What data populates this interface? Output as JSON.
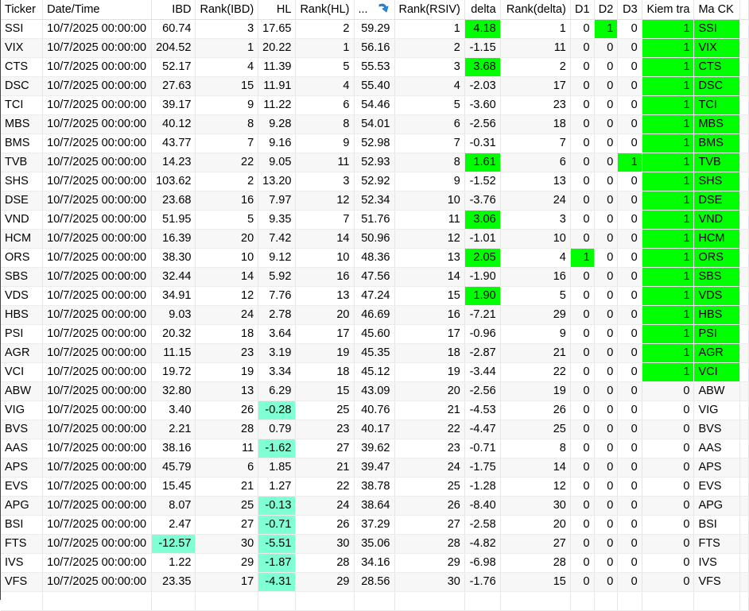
{
  "columns": [
    {
      "key": "ticker",
      "label": "Ticker",
      "align": "l"
    },
    {
      "key": "datetime",
      "label": "Date/Time",
      "align": "l"
    },
    {
      "key": "ibd",
      "label": "IBD",
      "align": "r"
    },
    {
      "key": "rank_ibd",
      "label": "Rank(IBD)",
      "align": "r"
    },
    {
      "key": "hl",
      "label": "HL",
      "align": "r"
    },
    {
      "key": "rank_hl",
      "label": "Rank(HL)",
      "align": "r"
    },
    {
      "key": "rsiv",
      "label": "...",
      "align": "l"
    },
    {
      "key": "rank_rsiv",
      "label": "Rank(RSIV)",
      "align": "r"
    },
    {
      "key": "delta",
      "label": "delta",
      "align": "r"
    },
    {
      "key": "rank_delta",
      "label": "Rank(delta)",
      "align": "r"
    },
    {
      "key": "d1",
      "label": "D1",
      "align": "r"
    },
    {
      "key": "d2",
      "label": "D2",
      "align": "r"
    },
    {
      "key": "d3",
      "label": "D3",
      "align": "r"
    },
    {
      "key": "kiem_tra",
      "label": "Kiem tra",
      "align": "r"
    },
    {
      "key": "ma_ck",
      "label": "Ma CK",
      "align": "l"
    }
  ],
  "sort_icon": "sort-descending-arrow-icon",
  "colors": {
    "green": "#00ff00",
    "aqua": "#7fffd4",
    "zebra": "#f7f7f7"
  },
  "rows": [
    {
      "v": [
        "SSI",
        "10/7/2025 00:00:00",
        "60.74",
        "3",
        "17.65",
        "2",
        "59.29",
        "1",
        "4.18",
        "1",
        "0",
        "1",
        "0",
        "1",
        "SSI"
      ],
      "g": [
        8,
        11,
        13,
        14
      ],
      "c": []
    },
    {
      "v": [
        "VIX",
        "10/7/2025 00:00:00",
        "204.52",
        "1",
        "20.22",
        "1",
        "56.16",
        "2",
        "-1.15",
        "11",
        "0",
        "0",
        "0",
        "1",
        "VIX"
      ],
      "g": [
        13,
        14
      ],
      "c": []
    },
    {
      "v": [
        "CTS",
        "10/7/2025 00:00:00",
        "52.17",
        "4",
        "11.39",
        "5",
        "55.53",
        "3",
        "3.68",
        "2",
        "0",
        "0",
        "0",
        "1",
        "CTS"
      ],
      "g": [
        8,
        13,
        14
      ],
      "c": []
    },
    {
      "v": [
        "DSC",
        "10/7/2025 00:00:00",
        "27.63",
        "15",
        "11.91",
        "4",
        "55.40",
        "4",
        "-2.03",
        "17",
        "0",
        "0",
        "0",
        "1",
        "DSC"
      ],
      "g": [
        13,
        14
      ],
      "c": []
    },
    {
      "v": [
        "TCI",
        "10/7/2025 00:00:00",
        "39.17",
        "9",
        "11.22",
        "6",
        "54.46",
        "5",
        "-3.60",
        "23",
        "0",
        "0",
        "0",
        "1",
        "TCI"
      ],
      "g": [
        13,
        14
      ],
      "c": []
    },
    {
      "v": [
        "MBS",
        "10/7/2025 00:00:00",
        "40.12",
        "8",
        "9.28",
        "8",
        "54.01",
        "6",
        "-2.56",
        "18",
        "0",
        "0",
        "0",
        "1",
        "MBS"
      ],
      "g": [
        13,
        14
      ],
      "c": []
    },
    {
      "v": [
        "BMS",
        "10/7/2025 00:00:00",
        "43.77",
        "7",
        "9.16",
        "9",
        "52.98",
        "7",
        "-0.31",
        "7",
        "0",
        "0",
        "0",
        "1",
        "BMS"
      ],
      "g": [
        13,
        14
      ],
      "c": []
    },
    {
      "v": [
        "TVB",
        "10/7/2025 00:00:00",
        "14.23",
        "22",
        "9.05",
        "11",
        "52.93",
        "8",
        "1.61",
        "6",
        "0",
        "0",
        "1",
        "1",
        "TVB"
      ],
      "g": [
        8,
        12,
        13,
        14
      ],
      "c": []
    },
    {
      "v": [
        "SHS",
        "10/7/2025 00:00:00",
        "103.62",
        "2",
        "13.20",
        "3",
        "52.92",
        "9",
        "-1.52",
        "13",
        "0",
        "0",
        "0",
        "1",
        "SHS"
      ],
      "g": [
        13,
        14
      ],
      "c": []
    },
    {
      "v": [
        "DSE",
        "10/7/2025 00:00:00",
        "23.68",
        "16",
        "7.97",
        "12",
        "52.34",
        "10",
        "-3.76",
        "24",
        "0",
        "0",
        "0",
        "1",
        "DSE"
      ],
      "g": [
        13,
        14
      ],
      "c": []
    },
    {
      "v": [
        "VND",
        "10/7/2025 00:00:00",
        "51.95",
        "5",
        "9.35",
        "7",
        "51.76",
        "11",
        "3.06",
        "3",
        "0",
        "0",
        "0",
        "1",
        "VND"
      ],
      "g": [
        8,
        13,
        14
      ],
      "c": []
    },
    {
      "v": [
        "HCM",
        "10/7/2025 00:00:00",
        "16.39",
        "20",
        "7.42",
        "14",
        "50.96",
        "12",
        "-1.01",
        "10",
        "0",
        "0",
        "0",
        "1",
        "HCM"
      ],
      "g": [
        13,
        14
      ],
      "c": []
    },
    {
      "v": [
        "ORS",
        "10/7/2025 00:00:00",
        "38.30",
        "10",
        "9.12",
        "10",
        "48.36",
        "13",
        "2.05",
        "4",
        "1",
        "0",
        "0",
        "1",
        "ORS"
      ],
      "g": [
        8,
        10,
        13,
        14
      ],
      "c": []
    },
    {
      "v": [
        "SBS",
        "10/7/2025 00:00:00",
        "32.44",
        "14",
        "5.92",
        "16",
        "47.56",
        "14",
        "-1.90",
        "16",
        "0",
        "0",
        "0",
        "1",
        "SBS"
      ],
      "g": [
        13,
        14
      ],
      "c": []
    },
    {
      "v": [
        "VDS",
        "10/7/2025 00:00:00",
        "34.91",
        "12",
        "7.76",
        "13",
        "47.24",
        "15",
        "1.90",
        "5",
        "0",
        "0",
        "0",
        "1",
        "VDS"
      ],
      "g": [
        8,
        13,
        14
      ],
      "c": []
    },
    {
      "v": [
        "HBS",
        "10/7/2025 00:00:00",
        "9.03",
        "24",
        "2.78",
        "20",
        "46.69",
        "16",
        "-7.21",
        "29",
        "0",
        "0",
        "0",
        "1",
        "HBS"
      ],
      "g": [
        13,
        14
      ],
      "c": []
    },
    {
      "v": [
        "PSI",
        "10/7/2025 00:00:00",
        "20.32",
        "18",
        "3.64",
        "17",
        "45.60",
        "17",
        "-0.96",
        "9",
        "0",
        "0",
        "0",
        "1",
        "PSI"
      ],
      "g": [
        13,
        14
      ],
      "c": []
    },
    {
      "v": [
        "AGR",
        "10/7/2025 00:00:00",
        "11.15",
        "23",
        "3.19",
        "19",
        "45.35",
        "18",
        "-2.87",
        "21",
        "0",
        "0",
        "0",
        "1",
        "AGR"
      ],
      "g": [
        13,
        14
      ],
      "c": []
    },
    {
      "v": [
        "VCI",
        "10/7/2025 00:00:00",
        "19.72",
        "19",
        "3.34",
        "18",
        "45.12",
        "19",
        "-3.44",
        "22",
        "0",
        "0",
        "0",
        "1",
        "VCI"
      ],
      "g": [
        13,
        14
      ],
      "c": []
    },
    {
      "v": [
        "ABW",
        "10/7/2025 00:00:00",
        "32.80",
        "13",
        "6.29",
        "15",
        "43.09",
        "20",
        "-2.56",
        "19",
        "0",
        "0",
        "0",
        "0",
        "ABW"
      ],
      "g": [],
      "c": []
    },
    {
      "v": [
        "VIG",
        "10/7/2025 00:00:00",
        "3.40",
        "26",
        "-0.28",
        "25",
        "40.76",
        "21",
        "-4.53",
        "26",
        "0",
        "0",
        "0",
        "0",
        "VIG"
      ],
      "g": [],
      "c": [
        4
      ]
    },
    {
      "v": [
        "BVS",
        "10/7/2025 00:00:00",
        "2.21",
        "28",
        "0.79",
        "23",
        "40.17",
        "22",
        "-4.47",
        "25",
        "0",
        "0",
        "0",
        "0",
        "BVS"
      ],
      "g": [],
      "c": []
    },
    {
      "v": [
        "AAS",
        "10/7/2025 00:00:00",
        "38.16",
        "11",
        "-1.62",
        "27",
        "39.62",
        "23",
        "-0.71",
        "8",
        "0",
        "0",
        "0",
        "0",
        "AAS"
      ],
      "g": [],
      "c": [
        4
      ]
    },
    {
      "v": [
        "APS",
        "10/7/2025 00:00:00",
        "45.79",
        "6",
        "1.85",
        "21",
        "39.47",
        "24",
        "-1.75",
        "14",
        "0",
        "0",
        "0",
        "0",
        "APS"
      ],
      "g": [],
      "c": []
    },
    {
      "v": [
        "EVS",
        "10/7/2025 00:00:00",
        "15.45",
        "21",
        "1.27",
        "22",
        "38.78",
        "25",
        "-1.28",
        "12",
        "0",
        "0",
        "0",
        "0",
        "EVS"
      ],
      "g": [],
      "c": []
    },
    {
      "v": [
        "APG",
        "10/7/2025 00:00:00",
        "8.07",
        "25",
        "-0.13",
        "24",
        "38.64",
        "26",
        "-8.40",
        "30",
        "0",
        "0",
        "0",
        "0",
        "APG"
      ],
      "g": [],
      "c": [
        4
      ]
    },
    {
      "v": [
        "BSI",
        "10/7/2025 00:00:00",
        "2.47",
        "27",
        "-0.71",
        "26",
        "37.29",
        "27",
        "-2.58",
        "20",
        "0",
        "0",
        "0",
        "0",
        "BSI"
      ],
      "g": [],
      "c": [
        4
      ]
    },
    {
      "v": [
        "FTS",
        "10/7/2025 00:00:00",
        "-12.57",
        "30",
        "-5.51",
        "30",
        "35.06",
        "28",
        "-4.82",
        "27",
        "0",
        "0",
        "0",
        "0",
        "FTS"
      ],
      "g": [],
      "c": [
        2,
        4
      ]
    },
    {
      "v": [
        "IVS",
        "10/7/2025 00:00:00",
        "1.22",
        "29",
        "-1.87",
        "28",
        "34.16",
        "29",
        "-6.98",
        "28",
        "0",
        "0",
        "0",
        "0",
        "IVS"
      ],
      "g": [],
      "c": [
        4
      ]
    },
    {
      "v": [
        "VFS",
        "10/7/2025 00:00:00",
        "23.35",
        "17",
        "-4.31",
        "29",
        "28.56",
        "30",
        "-1.76",
        "15",
        "0",
        "0",
        "0",
        "0",
        "VFS"
      ],
      "g": [],
      "c": [
        4
      ]
    }
  ]
}
